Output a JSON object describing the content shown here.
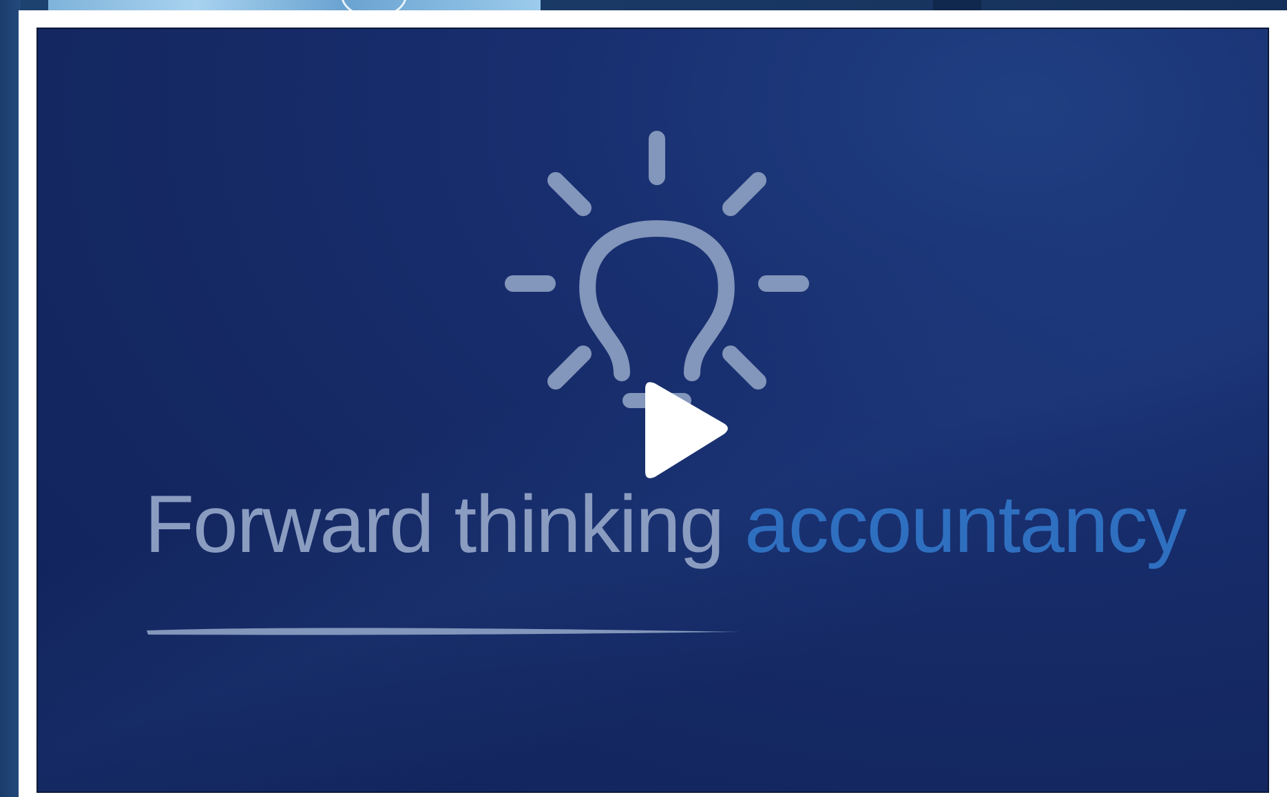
{
  "video": {
    "headline_part1": "Forward thinking",
    "headline_part2": "accountancy",
    "play_icon": "play-icon",
    "bulb_icon": "lightbulb-icon"
  },
  "colors": {
    "video_background": "#142761",
    "headline_grey": "#8a9cc0",
    "headline_accent": "#2f6fc0",
    "frame": "#ffffff"
  }
}
